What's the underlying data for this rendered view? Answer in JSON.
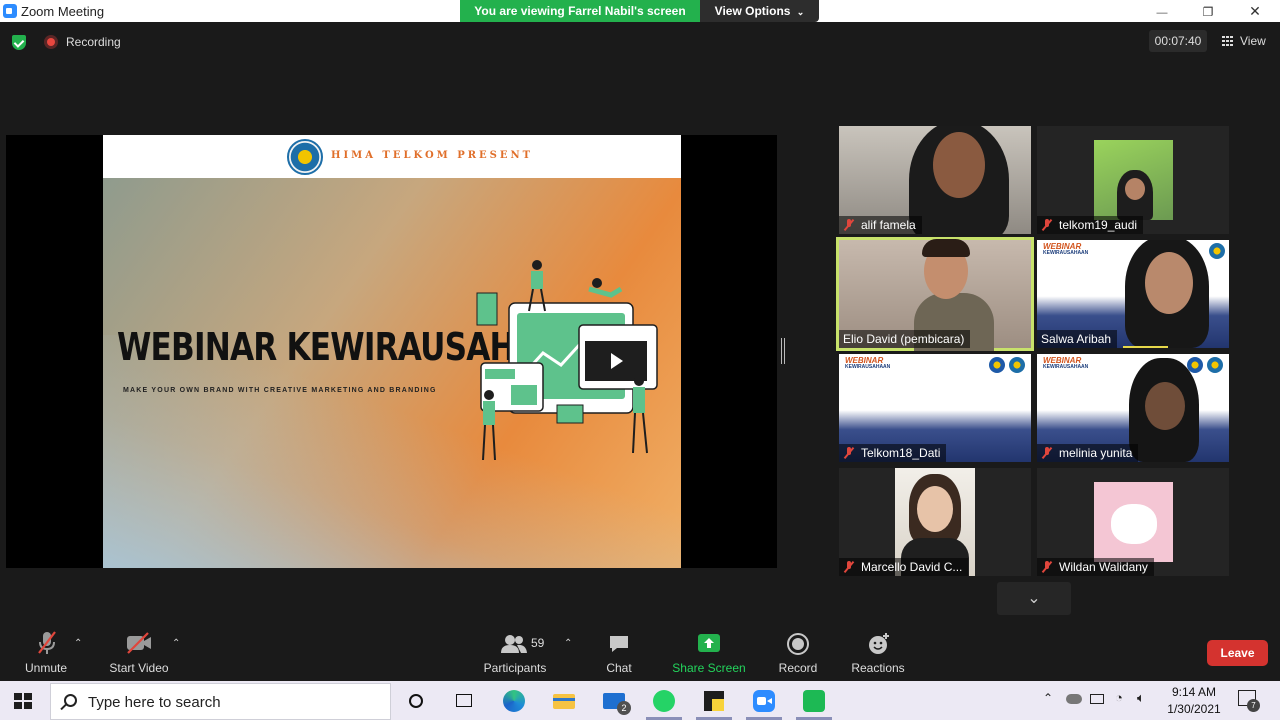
{
  "window": {
    "title": "Zoom Meeting",
    "viewing_banner": "You are viewing Farrel Nabil's screen",
    "view_options": "View Options",
    "minimize": "—",
    "maximize": "❐",
    "close": "✕"
  },
  "status": {
    "recording": "Recording",
    "timer": "00:07:40",
    "view": "View"
  },
  "slide": {
    "header": "HIMA TELKOM PRESENT",
    "title": "WEBINAR KEWIRAUSAHAAN",
    "subtitle": "MAKE YOUR OWN BRAND WITH CREATIVE MARKETING AND BRANDING"
  },
  "participants_tiles": [
    {
      "name": "alif famela",
      "muted": true
    },
    {
      "name": "telkom19_audi",
      "muted": true
    },
    {
      "name": "Elio David (pembicara)",
      "muted": false,
      "active_speaker": true
    },
    {
      "name": "Salwa Aribah",
      "muted": false
    },
    {
      "name": "Telkom18_Dati",
      "muted": true,
      "banner_title": "WEBINAR",
      "banner_sub": "KEWIRAUSAHAAN"
    },
    {
      "name": "melinia yunita",
      "muted": true,
      "banner_title": "WEBINAR",
      "banner_sub": "KEWIRAUSAHAAN"
    },
    {
      "name": "Marcello David C...",
      "muted": true
    },
    {
      "name": "Wildan Walidany",
      "muted": true
    }
  ],
  "salwa_banner": {
    "title": "WEBINAR",
    "sub": "KEWIRAUSAHAAN"
  },
  "toolbar": {
    "unmute": "Unmute",
    "start_video": "Start Video",
    "participants": "Participants",
    "participants_count": "59",
    "chat": "Chat",
    "share_screen": "Share Screen",
    "record": "Record",
    "reactions": "Reactions",
    "leave": "Leave"
  },
  "taskbar": {
    "search_placeholder": "Type here to search",
    "mail_badge": "2",
    "time": "9:14 AM",
    "date": "1/30/2021",
    "notification_badge": "7"
  },
  "colors": {
    "banner_green": "#23b14d",
    "leave_red": "#d4332f",
    "active_speaker": "#c8e26b",
    "zoom_blue": "#2d8cff"
  }
}
